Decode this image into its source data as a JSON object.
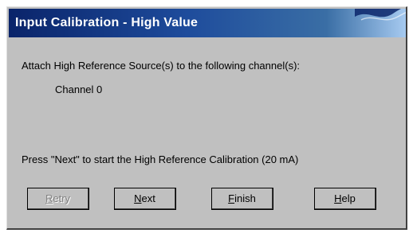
{
  "window": {
    "title": "Input Calibration - High Value",
    "accent_color": "#0a246a",
    "face_color": "#c0c0c0"
  },
  "body": {
    "instruction": "Attach High Reference Source(s) to  the following channel(s):",
    "channel": "Channel 0",
    "press_text": "Press \"Next\" to start the High Reference Calibration  (20 mA)"
  },
  "buttons": {
    "retry": {
      "first": "R",
      "rest": "etry",
      "enabled": false
    },
    "next": {
      "first": "N",
      "rest": "ext",
      "enabled": true
    },
    "finish": {
      "first": "F",
      "rest": "inish",
      "enabled": true
    },
    "help": {
      "first": "H",
      "rest": "elp",
      "enabled": true
    }
  }
}
